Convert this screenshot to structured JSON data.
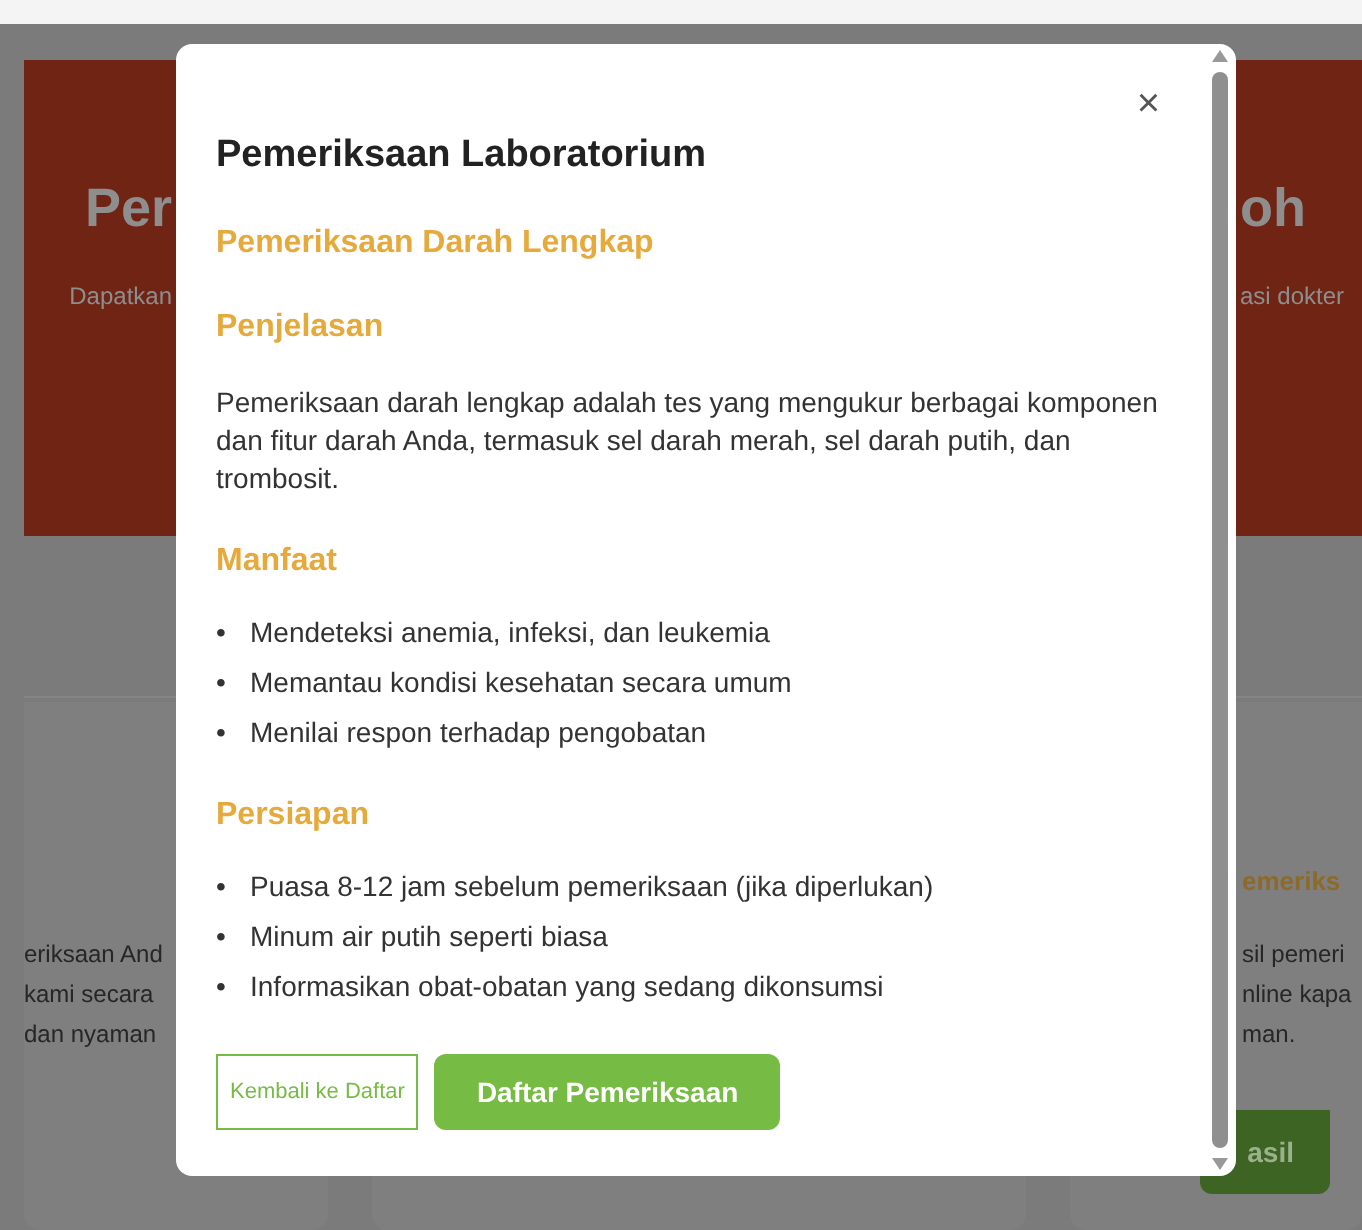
{
  "background": {
    "hero": {
      "title_left": "Per",
      "subtitle_left": "Dapatkan",
      "title_right": "oh",
      "subtitle_right": "asi dokter"
    },
    "left_card": {
      "lines": [
        "eriksaan And",
        "kami secara",
        "dan nyaman"
      ]
    },
    "right_card": {
      "title": "emeriks",
      "lines": [
        "sil pemeri",
        "nline kapa",
        "man."
      ],
      "button": "asil"
    }
  },
  "modal": {
    "title": "Pemeriksaan Laboratorium",
    "close": "×",
    "subtitle": "Pemeriksaan Darah Lengkap",
    "sections": [
      {
        "heading": "Penjelasan",
        "kind": "paragraph",
        "text": "Pemeriksaan darah lengkap adalah tes yang mengukur berbagai komponen dan fitur darah Anda, termasuk sel darah merah, sel darah putih, dan trombosit."
      },
      {
        "heading": "Manfaat",
        "kind": "list",
        "bullet": "•",
        "items": [
          "Mendeteksi anemia, infeksi, dan leukemia",
          "Memantau kondisi kesehatan secara umum",
          "Menilai respon terhadap pengobatan"
        ]
      },
      {
        "heading": "Persiapan",
        "kind": "list",
        "bullet": "•",
        "items": [
          "Puasa 8-12 jam sebelum pemeriksaan (jika diperlukan)",
          "Minum air putih seperti biasa",
          "Informasikan obat-obatan yang sedang dikonsumsi"
        ]
      }
    ],
    "buttons": [
      {
        "label": "Kembali ke Daftar",
        "kind": "outline"
      },
      {
        "label": "Daftar Pemeriksaan",
        "kind": "filled"
      }
    ]
  }
}
